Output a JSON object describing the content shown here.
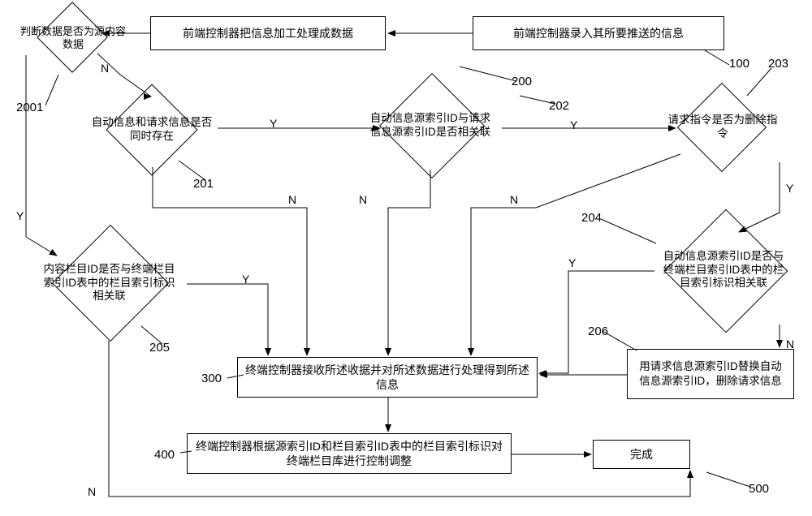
{
  "nodes": {
    "input": "前端控制器录入其所要推送的信息",
    "process": "前端控制器把信息加工处理成数据",
    "d_source": "判断数据是否为源内容数据",
    "d_auto_req": "自动信息和请求信息是否同时存在",
    "d_ids_related": "自动信息源索引ID与请求信息源索引ID是否相关联",
    "d_delete": "请求指令是否为删除指令",
    "d_content_col": "内容栏目ID是否与终端栏目索引ID表中的栏目索引标识相关联",
    "d_auto_col": "自动信息源索引ID是否与终端栏目索引ID表中的栏目索引标识相关联",
    "replace": "用请求信息源索引ID替换自动信息源索引ID，删除请求信息",
    "recv": "终端控制器接收所述收据并对所述数据进行处理得到所述信息",
    "adjust": "终端控制器根据源索引ID和栏目索引ID表中的栏目索引标识对终端栏目库进行控制调整",
    "done": "完成"
  },
  "labels": {
    "l100": "100",
    "l200": "200",
    "l2001": "2001",
    "l201": "201",
    "l202": "202",
    "l203": "203",
    "l204": "204",
    "l205": "205",
    "l206": "206",
    "l300": "300",
    "l400": "400",
    "l500": "500"
  },
  "yn": {
    "Y": "Y",
    "N": "N"
  },
  "chart_data": {
    "type": "flowchart",
    "nodes": [
      {
        "id": "N100",
        "kind": "process",
        "text": "前端控制器录入其所要推送的信息",
        "label": "100"
      },
      {
        "id": "N200",
        "kind": "process",
        "text": "前端控制器把信息加工处理成数据",
        "label": "200"
      },
      {
        "id": "N2001",
        "kind": "decision",
        "text": "判断数据是否为源内容数据",
        "label": "2001"
      },
      {
        "id": "N201",
        "kind": "decision",
        "text": "自动信息和请求信息是否同时存在",
        "label": "201"
      },
      {
        "id": "N202",
        "kind": "decision",
        "text": "自动信息源索引ID与请求信息源索引ID是否相关联",
        "label": "202"
      },
      {
        "id": "N203",
        "kind": "decision",
        "text": "请求指令是否为删除指令",
        "label": "203"
      },
      {
        "id": "N204",
        "kind": "decision",
        "text": "自动信息源索引ID是否与终端栏目索引ID表中的栏目索引标识相关联",
        "label": "204"
      },
      {
        "id": "N205",
        "kind": "decision",
        "text": "内容栏目ID是否与终端栏目索引ID表中的栏目索引标识相关联",
        "label": "205"
      },
      {
        "id": "N206",
        "kind": "process",
        "text": "用请求信息源索引ID替换自动信息源索引ID，删除请求信息",
        "label": "206"
      },
      {
        "id": "N300",
        "kind": "process",
        "text": "终端控制器接收所述收据并对所述数据进行处理得到所述信息",
        "label": "300"
      },
      {
        "id": "N400",
        "kind": "process",
        "text": "终端控制器根据源索引ID和栏目索引ID表中的栏目索引标识对终端栏目库进行控制调整",
        "label": "400"
      },
      {
        "id": "N500",
        "kind": "terminator",
        "text": "完成",
        "label": "500"
      }
    ],
    "edges": [
      {
        "from": "N100",
        "to": "N200"
      },
      {
        "from": "N200",
        "to": "N2001"
      },
      {
        "from": "N2001",
        "to": "N205",
        "label": "Y"
      },
      {
        "from": "N2001",
        "to": "N201",
        "label": "N"
      },
      {
        "from": "N201",
        "to": "N202",
        "label": "Y"
      },
      {
        "from": "N201",
        "to": "N300",
        "label": "N"
      },
      {
        "from": "N202",
        "to": "N203",
        "label": "Y"
      },
      {
        "from": "N202",
        "to": "N300",
        "label": "N"
      },
      {
        "from": "N203",
        "to": "N204",
        "label": "Y"
      },
      {
        "from": "N203",
        "to": "N300",
        "label": "N"
      },
      {
        "from": "N204",
        "to": "N300",
        "label": "Y"
      },
      {
        "from": "N204",
        "to": "N206",
        "label": "N"
      },
      {
        "from": "N206",
        "to": "N300"
      },
      {
        "from": "N205",
        "to": "N300",
        "label": "Y"
      },
      {
        "from": "N205",
        "to": "N500",
        "label": "N"
      },
      {
        "from": "N300",
        "to": "N400"
      },
      {
        "from": "N400",
        "to": "N500"
      }
    ]
  }
}
